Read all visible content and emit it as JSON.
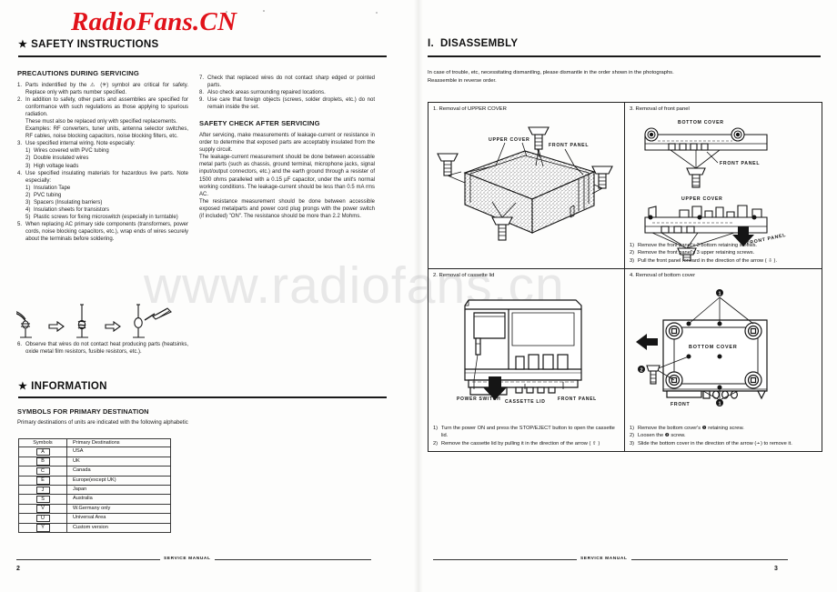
{
  "watermarks": {
    "brand": "RadioFans.CN",
    "url": "www.radiofans.cn"
  },
  "left_page": {
    "header": {
      "star": "★",
      "title": "SAFETY INSTRUCTIONS"
    },
    "col1": {
      "subhead": "PRECAUTIONS DURING SERVICING",
      "items": [
        {
          "num": "1.",
          "text": "Parts indentified by the ⚠ (✳) symbol are critical for safety. Replace only with parts number specified."
        },
        {
          "num": "2.",
          "text": "In addition to safety, other parts and assemblies are specified for conformance with such regulations as those applying to spurious radiation."
        },
        {
          "num": "",
          "text": "These must also be replaced only with specified replacements."
        },
        {
          "num": "",
          "text": "Examples: RF converters, tuner units, antenna selector switches, RF cables, noise blocking capacitors, noise blocking filters, etc."
        },
        {
          "num": "3.",
          "text": "Use specified internal wiring. Note especially:"
        }
      ],
      "sub_items_3": [
        {
          "num": "1)",
          "text": "Wires covered with PVC tubing"
        },
        {
          "num": "2)",
          "text": "Double insulated wires"
        },
        {
          "num": "3)",
          "text": "High voltage leads"
        }
      ],
      "item4": {
        "num": "4.",
        "text": "Use specified insulating materials for hazardous live parts. Note especially:"
      },
      "sub_items_4": [
        {
          "num": "1)",
          "text": "Insulation Tape"
        },
        {
          "num": "2)",
          "text": "PVC tubing"
        },
        {
          "num": "3)",
          "text": "Spacers (Insulating barriers)"
        },
        {
          "num": "4)",
          "text": "Insulation sheets for transistors"
        },
        {
          "num": "5)",
          "text": "Plastic screws for fixing microswitch (especially in turntable)"
        }
      ],
      "item5": {
        "num": "5.",
        "text": "When replacing AC primary side components (transformers, power cords, noise blocking capacitors, etc.), wrap ends of wires securely about the terminals before soldering."
      },
      "item6": {
        "num": "6.",
        "text": "Observe that wires do not contact heat producing parts (heatsinks, oxide metal film resistors, fusible resistors, etc.)."
      }
    },
    "col2": {
      "items": [
        {
          "num": "7.",
          "text": "Check that replaced wires do not contact sharp edged or pointed parts."
        },
        {
          "num": "8.",
          "text": "Also check areas surrounding repaired locations."
        },
        {
          "num": "9.",
          "text": "Use care that foreign objects (screws, solder droplets, etc.) do not remain inside the set."
        }
      ],
      "subhead": "SAFETY CHECK AFTER SERVICING",
      "paragraphs": [
        "After servicing, make measurements of leakage-current or resistance in order to determine that exposed parts are acceptably insulated from the supply circuit.",
        "The leakage-current measurement should be done between accessable metal parts (such as chassis, ground terminal, microphone jacks, signal input/output connectors, etc.) and the earth ground through a resister of 1500 ohms paralleled with a 0.15 µF capacitor, under the unit's normal working conditions. The leakage-current should be less than 0.5 mA rms AC.",
        "The resistance measurement should be done between accessible exposed metalparts and power cord plug prongs with the power switch (if included) \"ON\". The resistance should be more than 2.2 Mohms."
      ]
    },
    "information": {
      "header": {
        "star": "★",
        "title": "INFORMATION"
      },
      "subhead": "SYMBOLS FOR PRIMARY DESTINATION",
      "intro": "Primary destinations of units are indicated with the following alphabetic",
      "table": {
        "headers": [
          "Symbols",
          "Primary Destinations"
        ],
        "rows": [
          {
            "symbol": "A",
            "destination": "USA"
          },
          {
            "symbol": "B",
            "destination": "UK"
          },
          {
            "symbol": "C",
            "destination": "Canada"
          },
          {
            "symbol": "E",
            "destination": "Europe(except UK)"
          },
          {
            "symbol": "J",
            "destination": "Japan"
          },
          {
            "symbol": "S",
            "destination": "Australia"
          },
          {
            "symbol": "V",
            "destination": "W.Germany only"
          },
          {
            "symbol": "U",
            "destination": "Universal Area"
          },
          {
            "symbol": "Y",
            "destination": "Custom version"
          }
        ]
      }
    },
    "footer": {
      "text": "SERVICE MANUAL",
      "page": "2"
    }
  },
  "right_page": {
    "header": {
      "number": "I.",
      "title": "DISASSEMBLY"
    },
    "intro": [
      "In case of trouble, etc, necessitating dismantling, please dismantle in the order shown in the photographs.",
      "Reassemble in reverse order."
    ],
    "sections": [
      {
        "title": "1. Removal of UPPER COVER",
        "labels": [
          "UPPER COVER",
          "FRONT PANEL",
          "COVER"
        ],
        "steps": []
      },
      {
        "title": "3. Removal of front panel",
        "labels": [
          "BOTTOM COVER",
          "FRONT PANEL",
          "UPPER COVER",
          "FRONT PANEL"
        ],
        "steps": [
          {
            "num": "1)",
            "text": "Remove the front panel's 3 bottom retaining screws."
          },
          {
            "num": "2)",
            "text": "Remove the front panel's 3 upper retaining screws."
          },
          {
            "num": "3)",
            "text": "Pull the front panel forward in the direction of the arrow ( ⇩ )."
          }
        ]
      },
      {
        "title": "2. Removal of cassette lid",
        "labels": [
          "POWER SWITCH",
          "CASSETTE LID",
          "FRONT PANEL"
        ],
        "steps": [
          {
            "num": "1)",
            "text": "Turn the power ON and press the STOP/EJECT button to open the cassette lid."
          },
          {
            "num": "2)",
            "text": "Remove the cassette lid by pulling it in the direction of the arrow ( ⇧ )"
          }
        ]
      },
      {
        "title": "4. Removal of bottom cover",
        "labels": [
          "BOTTOM COVER",
          "FRONT"
        ],
        "steps": [
          {
            "num": "1)",
            "text": "Remove the bottom cover's ❶ retaining screw."
          },
          {
            "num": "2)",
            "text": "Loosen the ❷ screw."
          },
          {
            "num": "3)",
            "text": "Slide the bottom cover in the direction of the arrow (➛) to remove it."
          }
        ]
      }
    ],
    "footer": {
      "text": "SERVICE MANUAL",
      "page": "3"
    }
  }
}
